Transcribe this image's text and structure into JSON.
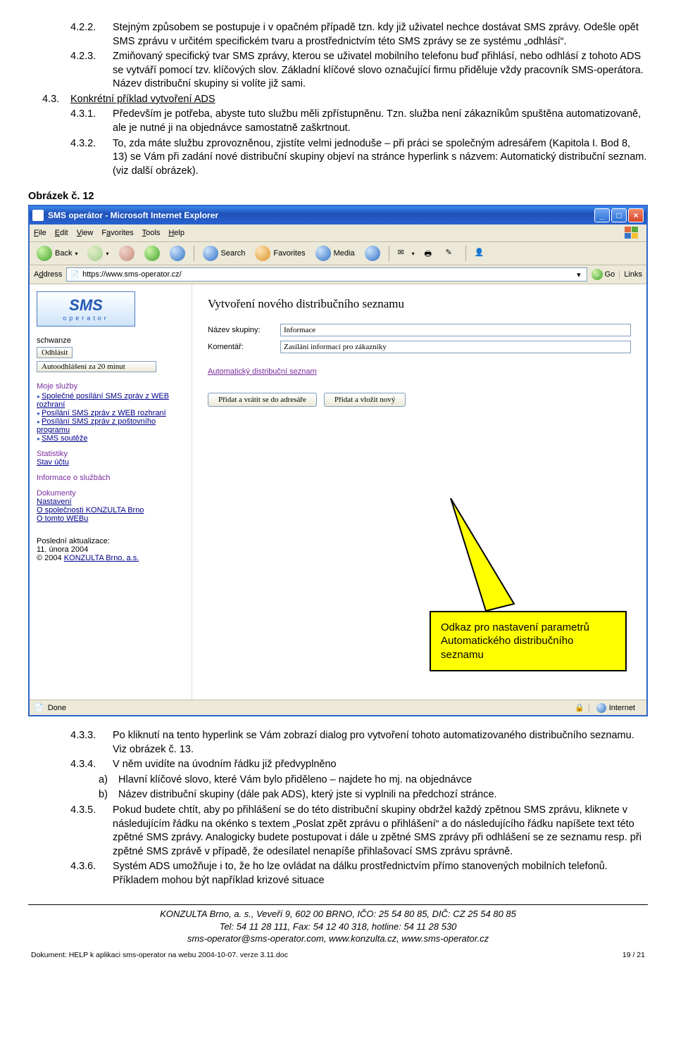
{
  "doc": {
    "items_top": [
      {
        "num": "4.2.2.",
        "text": "Stejným způsobem se postupuje i v opačném případě tzn. kdy již uživatel nechce dostávat SMS zprávy. Odešle opět SMS zprávu v určitém specifickém tvaru a prostřednictvím této SMS zprávy se ze systému „odhlásí“."
      },
      {
        "num": "4.2.3.",
        "text": "Zmiňovaný specifický tvar SMS zprávy, kterou se uživatel mobilního telefonu buď přihlásí, nebo odhlásí z tohoto ADS se vytváří pomocí tzv. klíčových slov. Základní klíčové slovo označující firmu přiděluje vždy pracovník SMS-operátora. Název distribuční skupiny si volíte již sami."
      }
    ],
    "heading43": "4.3.",
    "heading43_text": "Konkrétní příklad vytvoření ADS",
    "items_mid": [
      {
        "num": "4.3.1.",
        "text": "Především je potřeba, abyste tuto službu měli zpřístupněnu. Tzn. služba není zákazníkům spuštěna automatizovaně, ale je nutné ji na objednávce samostatně zaškrtnout."
      },
      {
        "num": "4.3.2.",
        "text": "To, zda máte službu zprovozněnou, zjistíte velmi jednoduše – při práci se společným adresářem (Kapitola I. Bod 8, 13) se Vám při zadání nové distribuční skupiny objeví na stránce hyperlink s názvem: Automatický distribuční seznam. (viz další obrázek)."
      }
    ],
    "obrazek_label": "Obrázek č. 12",
    "items_bottom": [
      {
        "num": "4.3.3.",
        "text": "Po kliknutí na tento hyperlink se Vám zobrazí dialog pro vytvoření tohoto automatizovaného distribučního seznamu. Viz obrázek č. 13."
      },
      {
        "num": "4.3.4.",
        "text": "V něm uvidíte na úvodním řádku již předvyplněno"
      },
      {
        "num": "4.3.5.",
        "text": "Pokud budete chtít, aby po přihlášení se do této distribuční skupiny obdržel každý zpětnou SMS zprávu, kliknete v následujícím řádku na okénko s textem „Poslat zpět zprávu o přihlášení“ a do následujícího řádku napíšete text této zpětné SMS zprávy. Analogicky budete postupovat i dále u zpětné SMS zprávy při odhlášení se ze seznamu resp. při zpětné SMS zprávě v případě, že odesílatel nenapíše přihlašovací SMS zprávu správně."
      },
      {
        "num": "4.3.6.",
        "text": "Systém ADS umožňuje i to, že ho lze ovládat na dálku prostřednictvím přímo stanovených mobilních telefonů. Příkladem mohou být například krizové situace"
      }
    ],
    "sub434": [
      {
        "num": "a)",
        "text": "Hlavní klíčové slovo, které Vám bylo přiděleno – najdete ho mj. na objednávce"
      },
      {
        "num": "b)",
        "text": "Název distribuční skupiny (dále pak ADS), který jste si vyplnili na předchozí stránce."
      }
    ],
    "footer": {
      "line1": "KONZULTA Brno, a. s., Veveří 9, 602 00 BRNO, IČO: 25 54 80 85, DIČ: CZ 25 54 80 85",
      "line2": "Tel: 54 11 28 111, Fax: 54 12 40 318, hotline: 54 11 28 530",
      "line3": "sms-operator@sms-operator.com, www.konzulta.cz, www.sms-operator.cz",
      "meta_left": "Dokument: HELP k aplikaci sms-operator na webu 2004-10-07. verze 3.11.doc",
      "meta_right": "19 / 21"
    }
  },
  "ie": {
    "title": "SMS operátor - Microsoft Internet Explorer",
    "menus": [
      "File",
      "Edit",
      "View",
      "Favorites",
      "Tools",
      "Help"
    ],
    "toolbar": {
      "back": "Back",
      "search": "Search",
      "favorites": "Favorites",
      "media": "Media"
    },
    "address_label": "Address",
    "url": "https://www.sms-operator.cz/",
    "go": "Go",
    "links": "Links",
    "status_done": "Done",
    "status_internet": "Internet"
  },
  "sidebar": {
    "logo_main": "SMS",
    "logo_sub": "operator",
    "user": "schwanze",
    "logout_btn": "Odhlásit",
    "autologout": "Autoodhlášení za 20 minut",
    "cat1": "Moje služby",
    "links1": [
      "Společné posílání SMS zpráv z WEB rozhraní",
      "Posílání SMS zpráv z WEB rozhraní",
      "Posílání SMS zpráv z poštovního programu",
      "SMS soutěže"
    ],
    "cat2": "Statistiky",
    "link_stav": "Stav účtu",
    "cat3": "Informace o službách",
    "cat4": "Dokumenty",
    "link_nast": "Nastavení",
    "link_konz": "O společnosti KONZULTA Brno",
    "link_web": "O tomto WEBu",
    "foot1": "Poslední aktualizace:",
    "foot2": "11. února 2004",
    "foot3": "© 2004 ",
    "foot3_link": "KONZULTA Brno, a.s."
  },
  "main": {
    "heading": "Vytvoření nového distribučního seznamu",
    "label_nazev": "Název skupiny:",
    "value_nazev": "Informace",
    "label_koment": "Komentář:",
    "value_koment": "Zasílání informací pro zákazníky",
    "autolink": "Automatický distribuční seznam",
    "btn1": "Přidat a vrátit se do adresáře",
    "btn2": "Přidat a vložit nový",
    "callout": "Odkaz pro nastavení parametrů Automatického distribučního seznamu"
  }
}
